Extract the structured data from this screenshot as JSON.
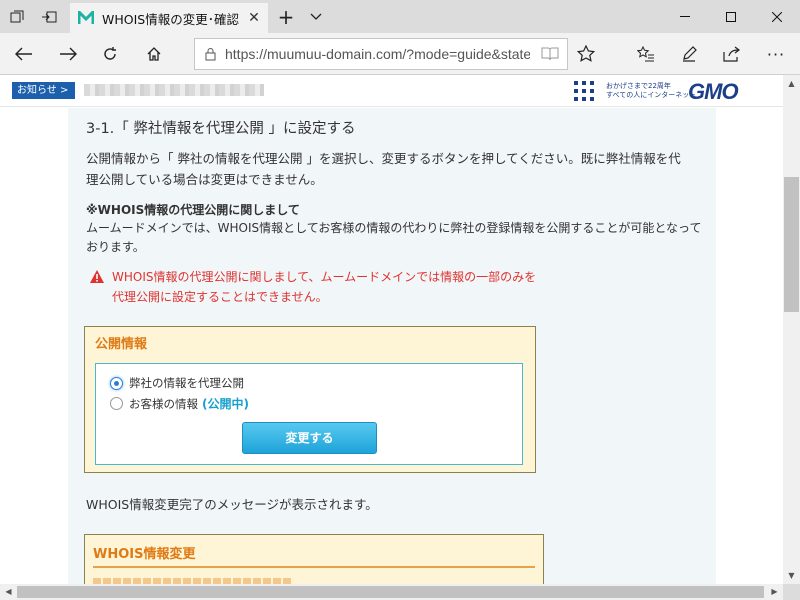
{
  "browser": {
    "tab_title": "WHOIS情報の変更･確認",
    "url": "https://muumuu-domain.com/?mode=guide&state="
  },
  "site_header": {
    "notice_label": "お知らせ >",
    "gmo_tagline_1": "おかげさまで22周年",
    "gmo_tagline_2": "すべての人にインターネット",
    "gmo_logo": "GMO"
  },
  "content": {
    "heading": "3-1.「 弊社情報を代理公開 」に設定する",
    "intro_line1": "公開情報から「 弊社の情報を代理公開 」を選択し、変更するボタンを押してください。既に弊社情報を代",
    "intro_line2": "理公開している場合は変更はできません。",
    "subheading": "※WHOIS情報の代理公開に関しまして",
    "sub_line1": "ムームードメインでは、WHOIS情報としてお客様の情報の代わりに弊社の登録情報を公開することが可能となって",
    "sub_line2": "おります。",
    "warning_line1": "WHOIS情報の代理公開に関しまして、ムームードメインでは情報の一部のみを",
    "warning_line2": "代理公開に設定することはできません。",
    "public_info_box": {
      "title": "公開情報",
      "option_proxy": "弊社の情報を代理公開",
      "option_customer": "お客様の情報",
      "customer_status": "(公開中)",
      "selected": "option_proxy",
      "change_button": "変更する"
    },
    "completion_message": "WHOIS情報変更完了のメッセージが表示されます。",
    "whois_change_box": {
      "title": "WHOIS情報変更"
    }
  },
  "colors": {
    "accent_orange": "#e07a14",
    "warning_red": "#e0332f",
    "button_blue": "#1ea3d9",
    "notice_blue": "#1c60ad"
  }
}
